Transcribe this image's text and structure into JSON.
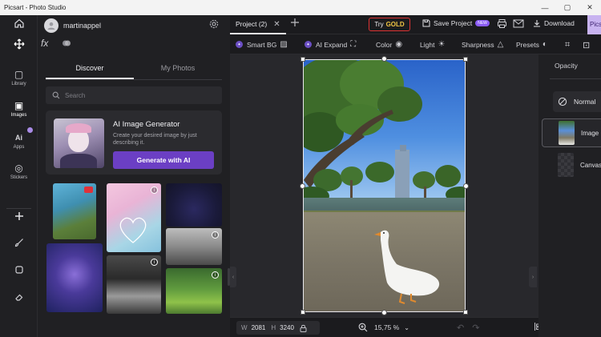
{
  "window": {
    "title": "Picsart - Photo Studio",
    "controls": [
      "—",
      "▢",
      "✕"
    ]
  },
  "rail": {
    "move_tool": "move-icon",
    "items": [
      {
        "label": "Library",
        "icon": "library-icon",
        "glyph": "▢"
      },
      {
        "label": "Images",
        "icon": "images-icon",
        "glyph": "▣"
      },
      {
        "label": "Apps",
        "icon": "apps-icon",
        "glyph": "Ai"
      },
      {
        "label": "Stickers",
        "icon": "stickers-icon",
        "glyph": "◎"
      }
    ],
    "bottom_tools": [
      "add-icon",
      "brush-icon",
      "shape-icon",
      "eraser-icon"
    ]
  },
  "user": {
    "name": "martinappel"
  },
  "left_panel": {
    "fx_label": "fx",
    "tabs": [
      {
        "label": "Discover",
        "active": true
      },
      {
        "label": "My Photos",
        "active": false
      }
    ],
    "search_placeholder": "Search",
    "ai_card": {
      "title": "AI Image Generator",
      "description": "Create your desired image by just describing it.",
      "button": "Generate with AI"
    }
  },
  "topbar": {
    "project_tab": "Project (2)",
    "try_label": "Try",
    "gold_label": "GOLD",
    "save_project": "Save Project",
    "new_badge": "NEW",
    "download": "Download",
    "brand_button": "Picsart"
  },
  "tools": [
    {
      "label": "Smart BG",
      "badge": true
    },
    {
      "label": "AI Expand",
      "badge": true
    },
    {
      "label": "Color",
      "badge": false
    },
    {
      "label": "Light",
      "badge": false
    },
    {
      "label": "Sharpness",
      "badge": false
    },
    {
      "label": "Presets",
      "badge": false
    }
  ],
  "bottombar": {
    "width_label": "W",
    "width_value": "2081",
    "height_label": "H",
    "height_value": "3240",
    "zoom": "15,75 %"
  },
  "right_panel": {
    "tab": "Opacity",
    "blend_mode": "Normal",
    "layers": [
      {
        "label": "Image",
        "selected": true
      },
      {
        "label": "Canvas",
        "selected": false
      }
    ]
  },
  "colors": {
    "accent_purple": "#6b3fc4",
    "gold": "#f0c544",
    "panel": "#202023",
    "canvas": "#28282c"
  }
}
